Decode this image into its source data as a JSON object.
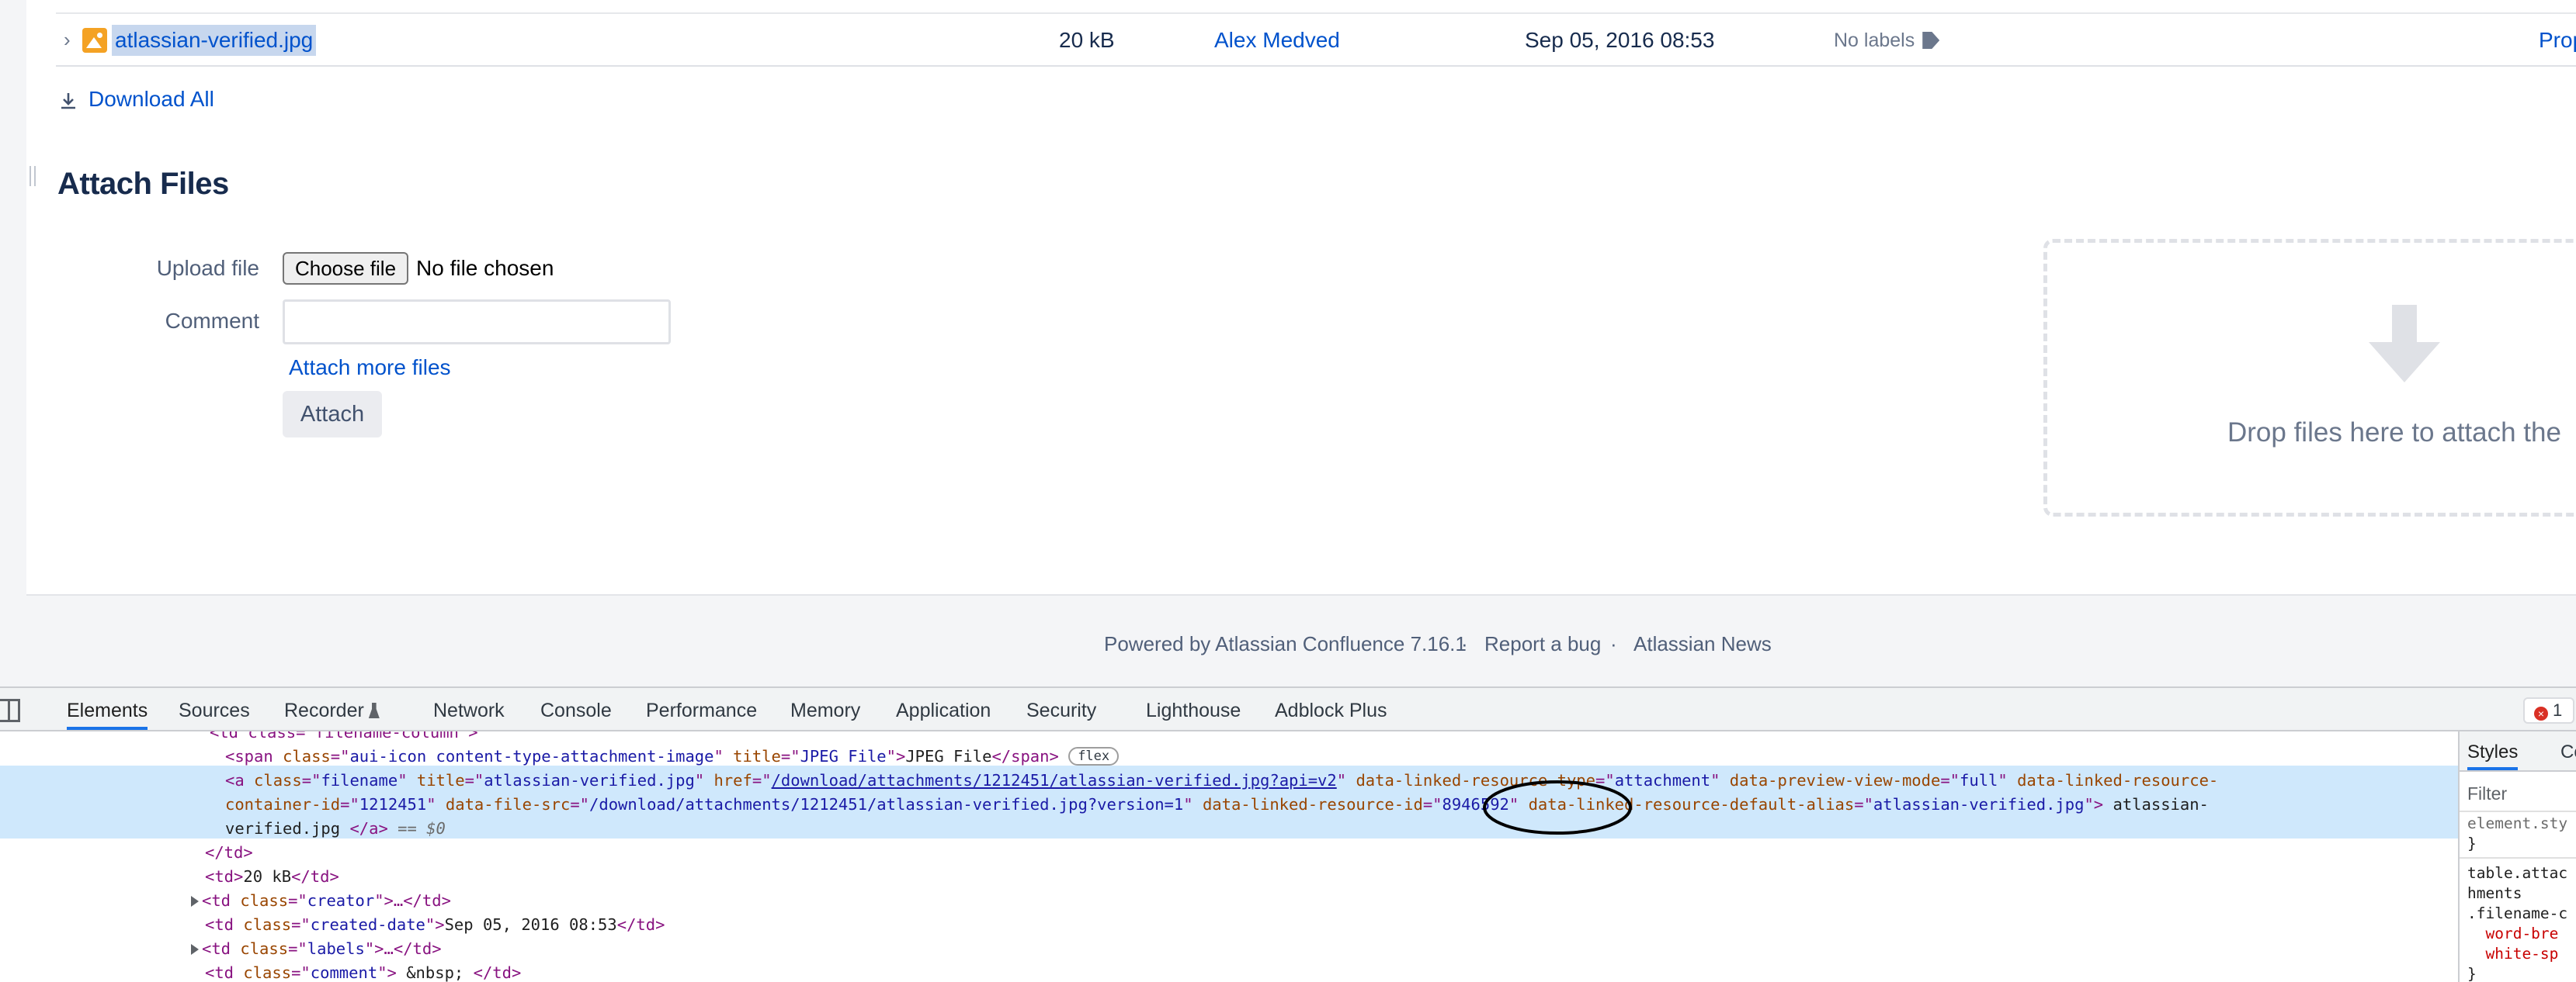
{
  "attachment": {
    "filename": "atlassian-verified.jpg",
    "size": "20 kB",
    "creator": "Alex Medved",
    "date": "Sep 05, 2016 08:53",
    "labels": "No labels",
    "properties": "Prop"
  },
  "download_all": "Download All",
  "attach": {
    "title": "Attach Files",
    "upload_label": "Upload file",
    "choose_file": "Choose file",
    "no_file": "No file chosen",
    "comment_label": "Comment",
    "comment_value": "",
    "attach_more": "Attach more files",
    "attach_button": "Attach",
    "drop_text": "Drop files here to attach the"
  },
  "footer": {
    "powered": "Powered by Atlassian Confluence 7.16.1",
    "dot": "·",
    "report_bug": "Report a bug",
    "news": "Atlassian News"
  },
  "devtools": {
    "tabs": [
      "Elements",
      "Sources",
      "Recorder",
      "Network",
      "Console",
      "Performance",
      "Memory",
      "Application",
      "Security",
      "Lighthouse",
      "Adblock Plus"
    ],
    "errors": "1",
    "styles_tabs": [
      "Styles",
      "Co"
    ],
    "filter_placeholder": "Filter",
    "styles_lines": [
      "element.sty",
      "}",
      "table.attac",
      "hments",
      ".filename-c",
      "  word-bre",
      "  white-sp",
      "}"
    ],
    "dom": {
      "line0": "<td class=\"filename-column\">",
      "span_class": "aui-icon content-type-attachment-image",
      "span_title": "JPEG File",
      "span_text": "JPEG File",
      "flex": "flex",
      "a_class": "filename",
      "a_title": "atlassian-verified.jpg",
      "a_href": "/download/attachments/1212451/atlassian-verified.jpg?api=v2",
      "a_resource_type": "attachment",
      "a_preview_mode": "full",
      "a_container_id_attr": "data-linked-resource-",
      "a_container_id_attr2": "container-id",
      "a_container_id": "1212451",
      "a_file_src": "/download/attachments/1212451/atlassian-verified.jpg?version=1",
      "a_resource_id": "8946592",
      "a_default_alias": "atlassian-verified.jpg",
      "a_text1": " atlassian-",
      "a_text2": "verified.jpg ",
      "eq": "== $0",
      "td_size": "20 kB",
      "creator_class": "creator",
      "date_class": "created-date",
      "date_text": "Sep 05, 2016 08:53",
      "labels_class": "labels",
      "comment_class": "comment",
      "comment_text": " &nbsp; "
    }
  },
  "colors": {
    "link": "#0052cc",
    "selection": "#c7d7ee",
    "devtools_selection": "#cfe8fc",
    "tag": "#881280",
    "attr_name": "#994500",
    "attr_value": "#1a1aa6"
  }
}
